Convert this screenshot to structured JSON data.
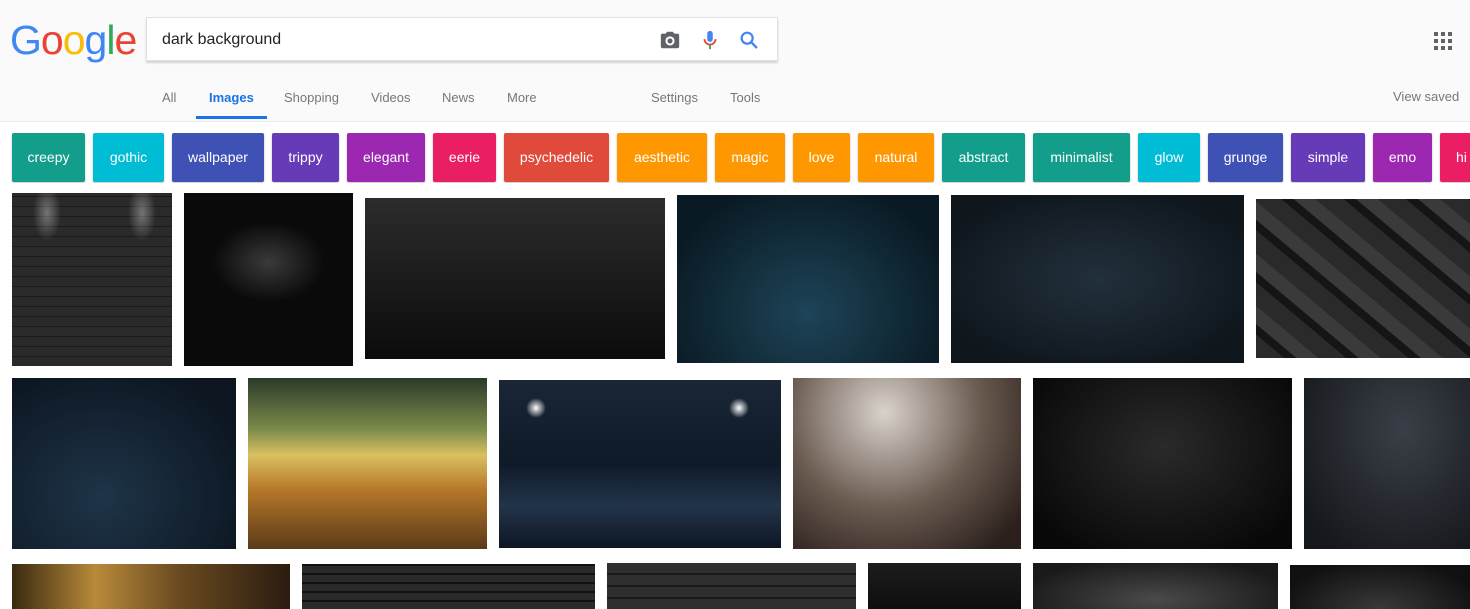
{
  "logo": {
    "letters": [
      "G",
      "o",
      "o",
      "g",
      "l",
      "e"
    ],
    "colors": [
      "#4285f4",
      "#ea4335",
      "#fbbc05",
      "#4285f4",
      "#34a853",
      "#ea4335"
    ]
  },
  "search": {
    "query": "dark background",
    "icons": [
      "camera-icon",
      "microphone-icon",
      "search-icon"
    ]
  },
  "tabs": [
    "All",
    "Images",
    "Shopping",
    "Videos",
    "News",
    "More",
    "Settings",
    "Tools"
  ],
  "active_tab": "Images",
  "view_saved": "View saved",
  "chips": [
    {
      "label": "creepy",
      "color": "#129e8a"
    },
    {
      "label": "gothic",
      "color": "#00bcd4"
    },
    {
      "label": "wallpaper",
      "color": "#3f51b5"
    },
    {
      "label": "trippy",
      "color": "#673ab7"
    },
    {
      "label": "elegant",
      "color": "#9c27b0"
    },
    {
      "label": "eerie",
      "color": "#e91e63"
    },
    {
      "label": "psychedelic",
      "color": "#e04a3b"
    },
    {
      "label": "aesthetic",
      "color": "#ff9800"
    },
    {
      "label": "magic",
      "color": "#ff9800"
    },
    {
      "label": "love",
      "color": "#ff9800"
    },
    {
      "label": "natural",
      "color": "#ff9800"
    },
    {
      "label": "abstract",
      "color": "#129e8a"
    },
    {
      "label": "minimalist",
      "color": "#129e8a"
    },
    {
      "label": "glow",
      "color": "#00bcd4"
    },
    {
      "label": "grunge",
      "color": "#3f51b5"
    },
    {
      "label": "simple",
      "color": "#673ab7"
    },
    {
      "label": "emo",
      "color": "#9c27b0"
    },
    {
      "label": "hi",
      "color": "#e91e63"
    }
  ],
  "images": [
    "brick wall with spotlights",
    "black room with spotlight",
    "black speckled texture",
    "dark blue starry sky",
    "dark blue grunge texture",
    "black triangle geometric pattern",
    "dark blue night sky",
    "green and orange glow",
    "dark parking lot with street lamps",
    "gray and brown blur",
    "black damask pattern",
    "dark gray gradient",
    "orange and black blur",
    "black wood plank texture",
    "dark brick wall",
    "black texture",
    "dark gray vignette",
    "black grunge texture"
  ]
}
